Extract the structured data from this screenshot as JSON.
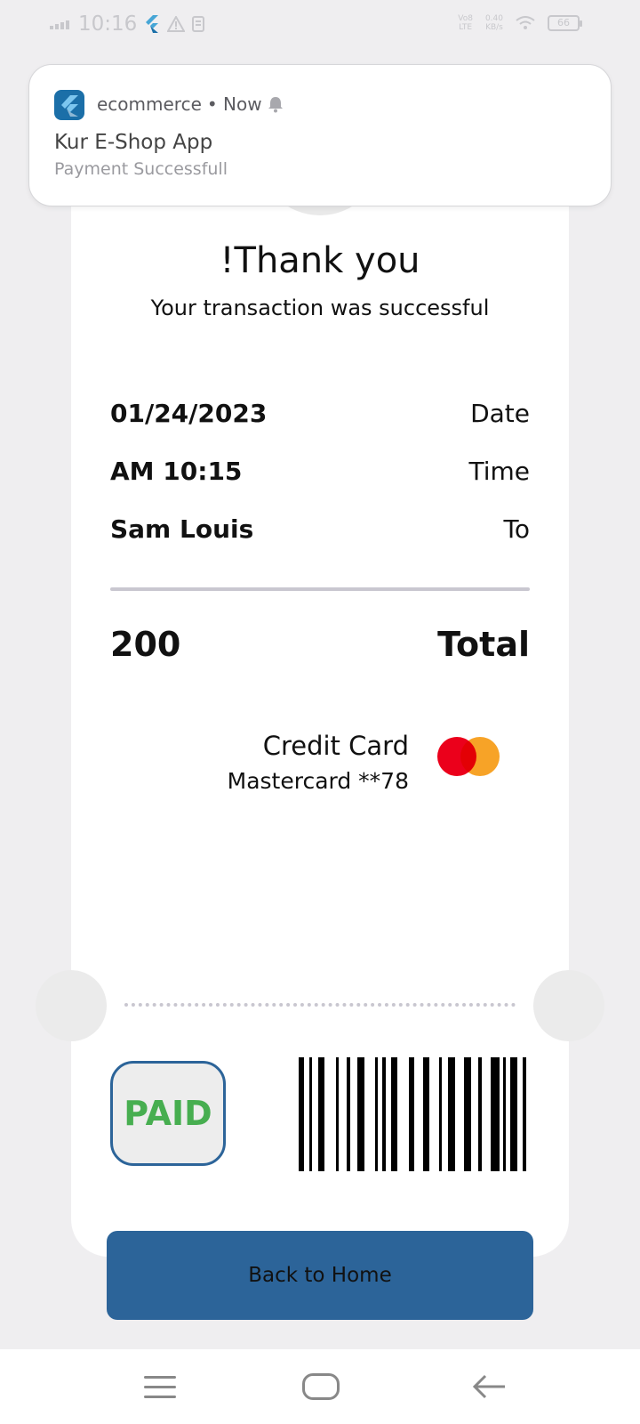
{
  "status_bar": {
    "time": "10:16",
    "network_top": "Vo8",
    "network_bottom": "LTE",
    "speed_top": "0.40",
    "speed_bottom": "KB/s",
    "battery": "66"
  },
  "notification": {
    "app_name": "ecommerce",
    "when": "• Now",
    "title": "Kur E-Shop App",
    "body": "Payment Successfull"
  },
  "receipt": {
    "heading": "!Thank you",
    "subtitle": "Your transaction was successful",
    "rows": [
      {
        "value": "01/24/2023",
        "label": "Date"
      },
      {
        "value": "AM 10:15",
        "label": "Time"
      },
      {
        "value": "Sam Louis",
        "label": "To"
      }
    ],
    "total": {
      "value": "200",
      "label": "Total"
    },
    "payment": {
      "method": "Credit Card",
      "card": "Mastercard **78"
    },
    "stamp": "PAID"
  },
  "actions": {
    "home_label": "Back to Home"
  },
  "colors": {
    "primary": "#2c6499",
    "success": "#3fae49",
    "mastercard_red": "#eb001b",
    "mastercard_orange": "#f79e1b"
  }
}
